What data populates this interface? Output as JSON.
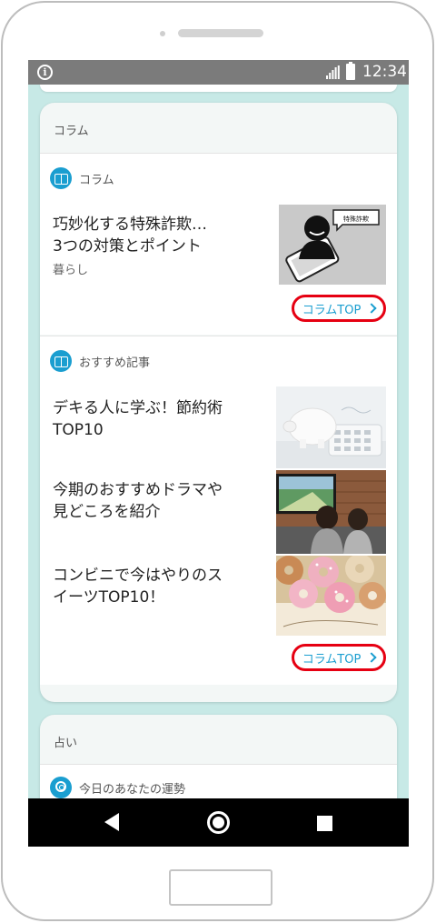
{
  "status_bar": {
    "time": "12:34"
  },
  "columns_card": {
    "header": "コラム",
    "section_column": {
      "label": "コラム",
      "article": {
        "title_line1": "巧妙化する特殊詐欺…",
        "title_line2": "3つの対策とポイント",
        "category": "暮らし",
        "thumb_bubble_text": "特殊詐欺"
      },
      "top_button": "コラムTOP"
    },
    "section_recommended": {
      "label": "おすすめ記事",
      "articles": [
        {
          "title_line1": "デキる人に学ぶ！節約術",
          "title_line2": "TOP10"
        },
        {
          "title_line1": "今期のおすすめドラマや",
          "title_line2": "見どころを紹介"
        },
        {
          "title_line1": "コンビニで今はやりのス",
          "title_line2": "イーツTOP10！"
        }
      ],
      "top_button": "コラムTOP"
    }
  },
  "fortune_card": {
    "header": "占い",
    "section": {
      "label": "今日のあなたの運勢"
    }
  },
  "icons": {
    "status": [
      "info-icon",
      "signal-icon",
      "battery-icon"
    ],
    "section": [
      "book-icon",
      "fortune-icon"
    ],
    "nav": [
      "back-icon",
      "home-icon",
      "recent-apps-icon"
    ],
    "button": "chevron-right-icon"
  },
  "colors": {
    "accent": "#1a9ed0",
    "highlight_ring": "#e60012",
    "background": "#c7e9e6",
    "status_bar": "#7b7b7b"
  }
}
